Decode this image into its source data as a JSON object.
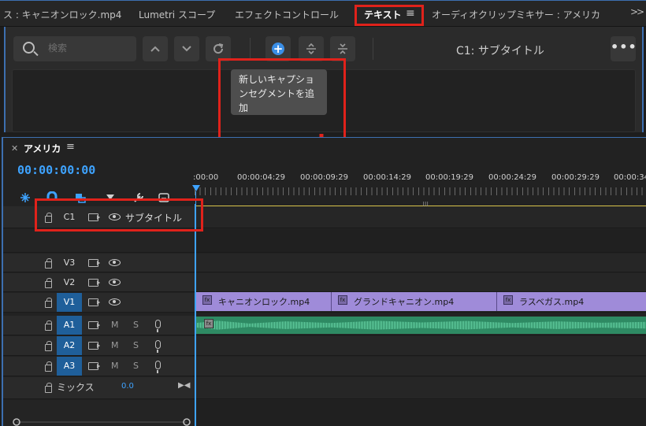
{
  "tabs": {
    "prev_label": "ス : キャニオンロック.mp4",
    "lumetri_label": "Lumetri スコープ",
    "effect_control_label": "エフェクトコントロール",
    "text_label": "テキスト",
    "audio_mixer_label": "オーディオクリップミキサー : アメリカ",
    "overflow_icon": "chevron-double-right-icon"
  },
  "text_panel": {
    "search_placeholder": "検索",
    "track_label": "C1: サブタイトル",
    "tooltip": "新しいキャプションセグメントを追加",
    "more_label": "•••",
    "add_icon_glyph": "+"
  },
  "sequence": {
    "title": "アメリカ",
    "timecode": "00:00:00:00",
    "ruler": [
      ":00:00",
      "00:00:04:29",
      "00:00:09:29",
      "00:00:14:29",
      "00:00:19:29",
      "00:00:24:29",
      "00:00:29:29",
      "00:00:34:"
    ],
    "caption_track": {
      "name": "C1",
      "label": "サブタイトル"
    },
    "video_tracks": [
      "V3",
      "V2",
      "V1"
    ],
    "audio_tracks": [
      "A1",
      "A2",
      "A3"
    ],
    "mute_label": "M",
    "solo_label": "S",
    "mix_label": "ミックス",
    "mix_value": "0.0",
    "clips": [
      "キャニオンロック.mp4",
      "グランドキャニオン.mp4",
      "ラスベガス.mp4"
    ],
    "fx_label": "fx"
  },
  "colors": {
    "highlight_red": "#e0221b",
    "accent_blue": "#3ea3ff",
    "clip_purple": "#9f8bd9",
    "audio_green": "#2e8a63"
  }
}
